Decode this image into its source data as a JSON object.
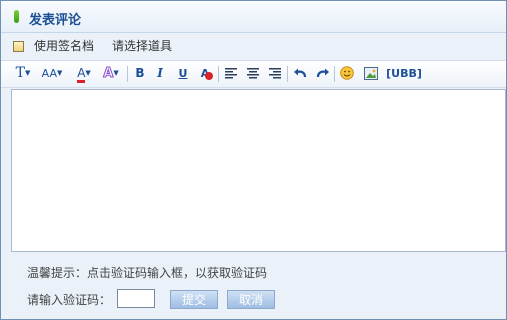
{
  "title": "发表评论",
  "options": {
    "signature_label": "使用签名档",
    "tool_select_label": "请选择道具"
  },
  "toolbar": {
    "font_glyph": "T",
    "fontsize_glyph": "AA",
    "forecolor_glyph": "A",
    "bgcolor_glyph": "A",
    "bold_glyph": "B",
    "italic_glyph": "I",
    "underline_glyph": "U",
    "remove_format_glyph": "A",
    "ubb_label": "[UBB]"
  },
  "tip": "温馨提示：点击验证码输入框，以获取验证码",
  "captcha": {
    "label": "请输入验证码：",
    "value": ""
  },
  "buttons": {
    "submit": "提交",
    "cancel": "取消"
  },
  "colors": {
    "title": "#1b4f93",
    "background": "#eaf1f9",
    "button": "#9fbde3"
  }
}
